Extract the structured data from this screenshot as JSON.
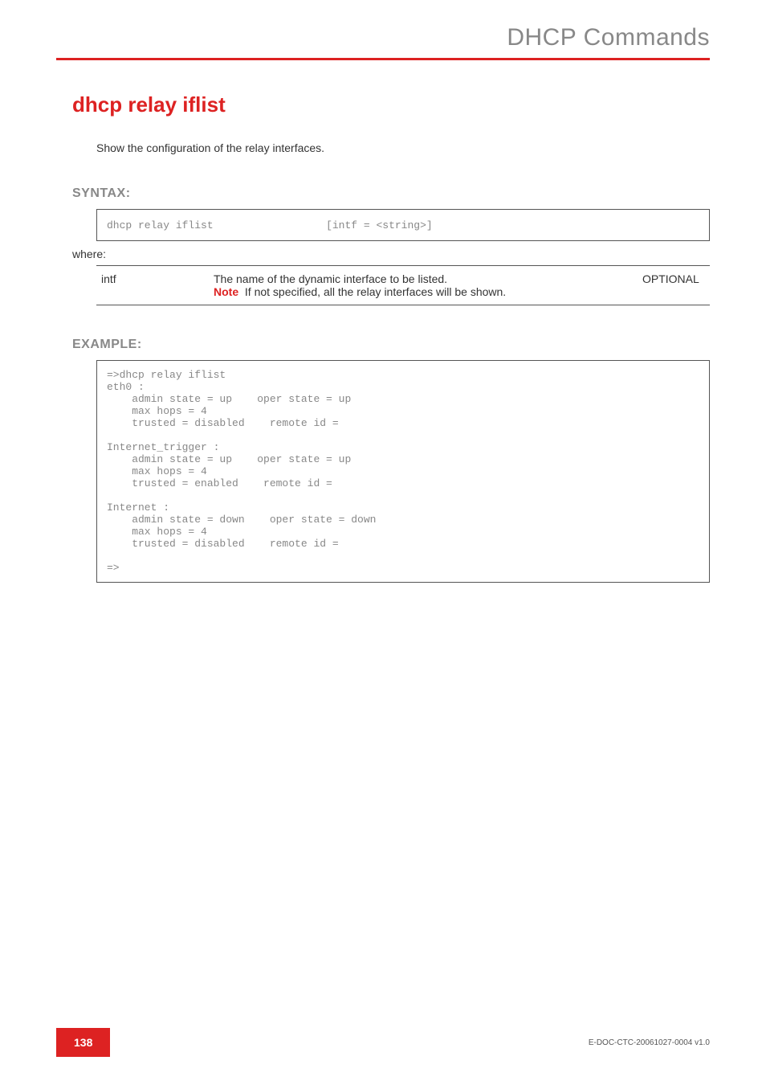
{
  "header": {
    "breadcrumb": "DHCP Commands"
  },
  "page": {
    "title": "dhcp relay iflist",
    "description": "Show the configuration of the relay interfaces."
  },
  "syntax": {
    "label": "SYNTAX:",
    "command": "dhcp relay iflist",
    "args": "[intf = <string>]",
    "where": "where:",
    "params": [
      {
        "name": "intf",
        "desc_line1": "The name of the dynamic interface to be listed.",
        "note_label": "Note",
        "note_text": "If not specified, all the relay interfaces will be shown.",
        "flag": "OPTIONAL"
      }
    ]
  },
  "example": {
    "label": "EXAMPLE:",
    "output": "=>dhcp relay iflist\neth0 :\n    admin state = up    oper state = up\n    max hops = 4\n    trusted = disabled    remote id =\n\nInternet_trigger :\n    admin state = up    oper state = up\n    max hops = 4\n    trusted = enabled    remote id =\n\nInternet :\n    admin state = down    oper state = down\n    max hops = 4\n    trusted = disabled    remote id =\n\n=>"
  },
  "footer": {
    "page_number": "138",
    "doc_id": "E-DOC-CTC-20061027-0004 v1.0"
  }
}
